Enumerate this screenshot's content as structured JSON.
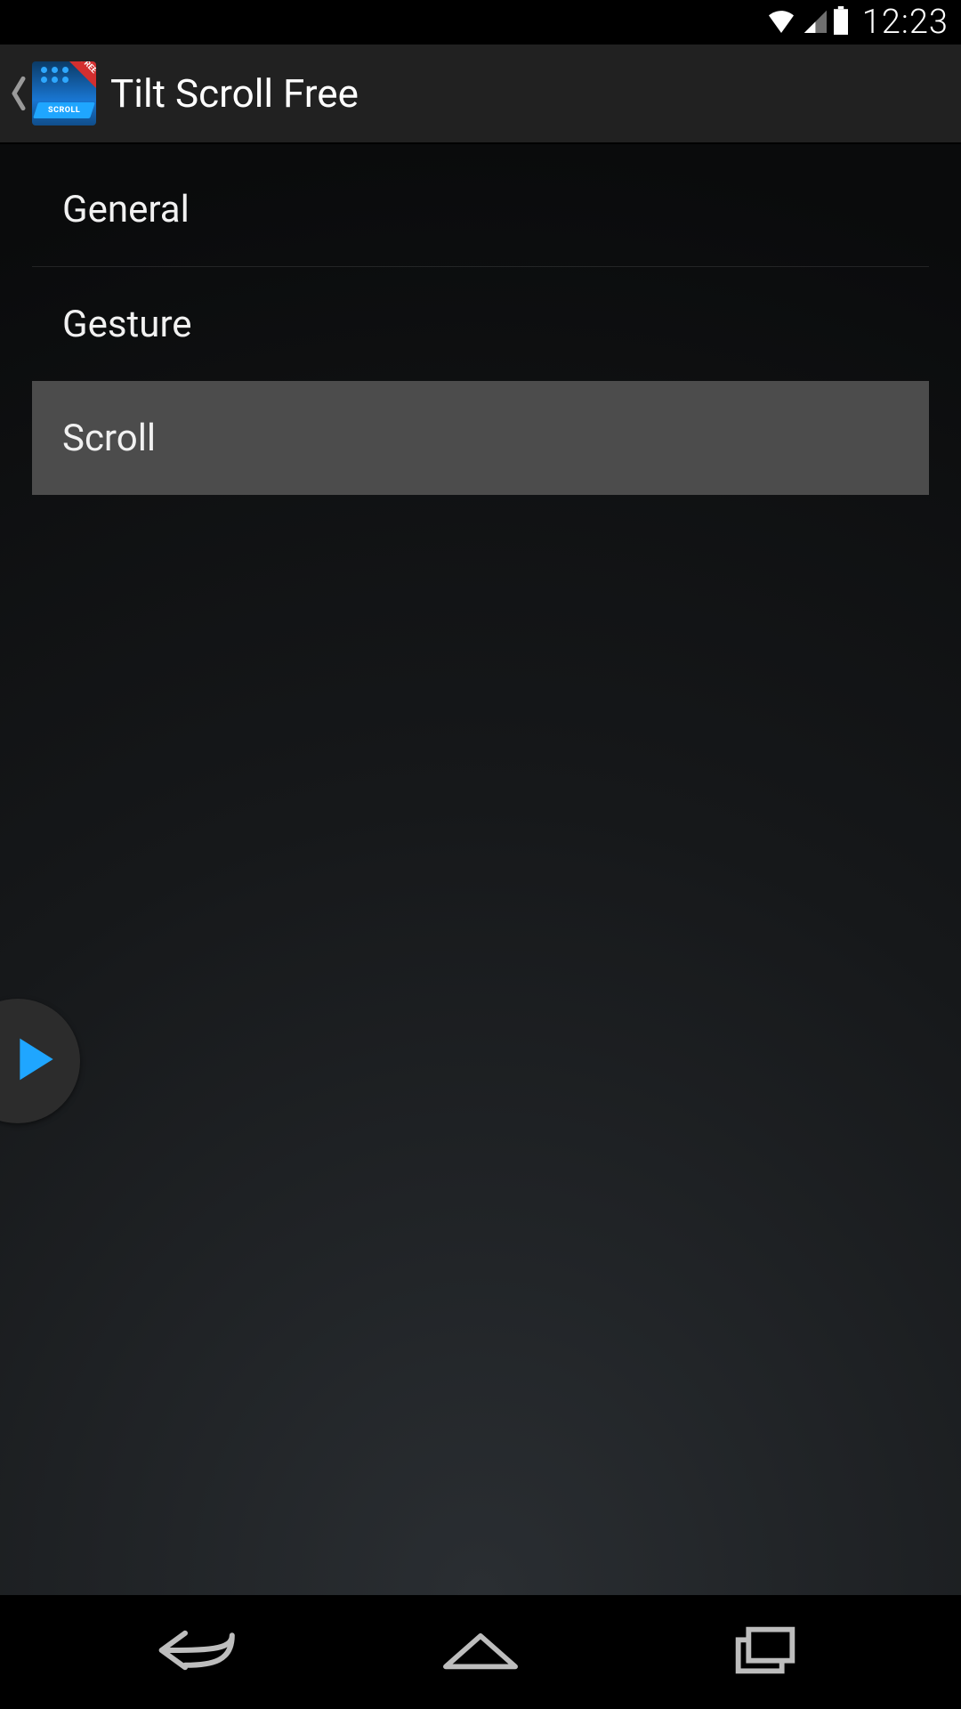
{
  "status": {
    "time": "12:23",
    "wifi_icon": "wifi-icon",
    "signal_icon": "cellular-icon",
    "battery_icon": "battery-icon"
  },
  "header": {
    "back_icon": "back-caret-icon",
    "app_icon": {
      "badge_text": "FREE",
      "band_text": "SCROLL"
    },
    "title": "Tilt Scroll Free"
  },
  "list": {
    "items": [
      {
        "label": "General",
        "selected": false
      },
      {
        "label": "Gesture",
        "selected": false
      },
      {
        "label": "Scroll",
        "selected": true
      }
    ]
  },
  "floating": {
    "play_icon": "play-icon"
  },
  "navbar": {
    "back_icon": "nav-back-icon",
    "home_icon": "nav-home-icon",
    "recent_icon": "nav-recent-icon"
  },
  "colors": {
    "accent_blue": "#1fa6ff",
    "selected_bg": "#4c4c4c"
  }
}
